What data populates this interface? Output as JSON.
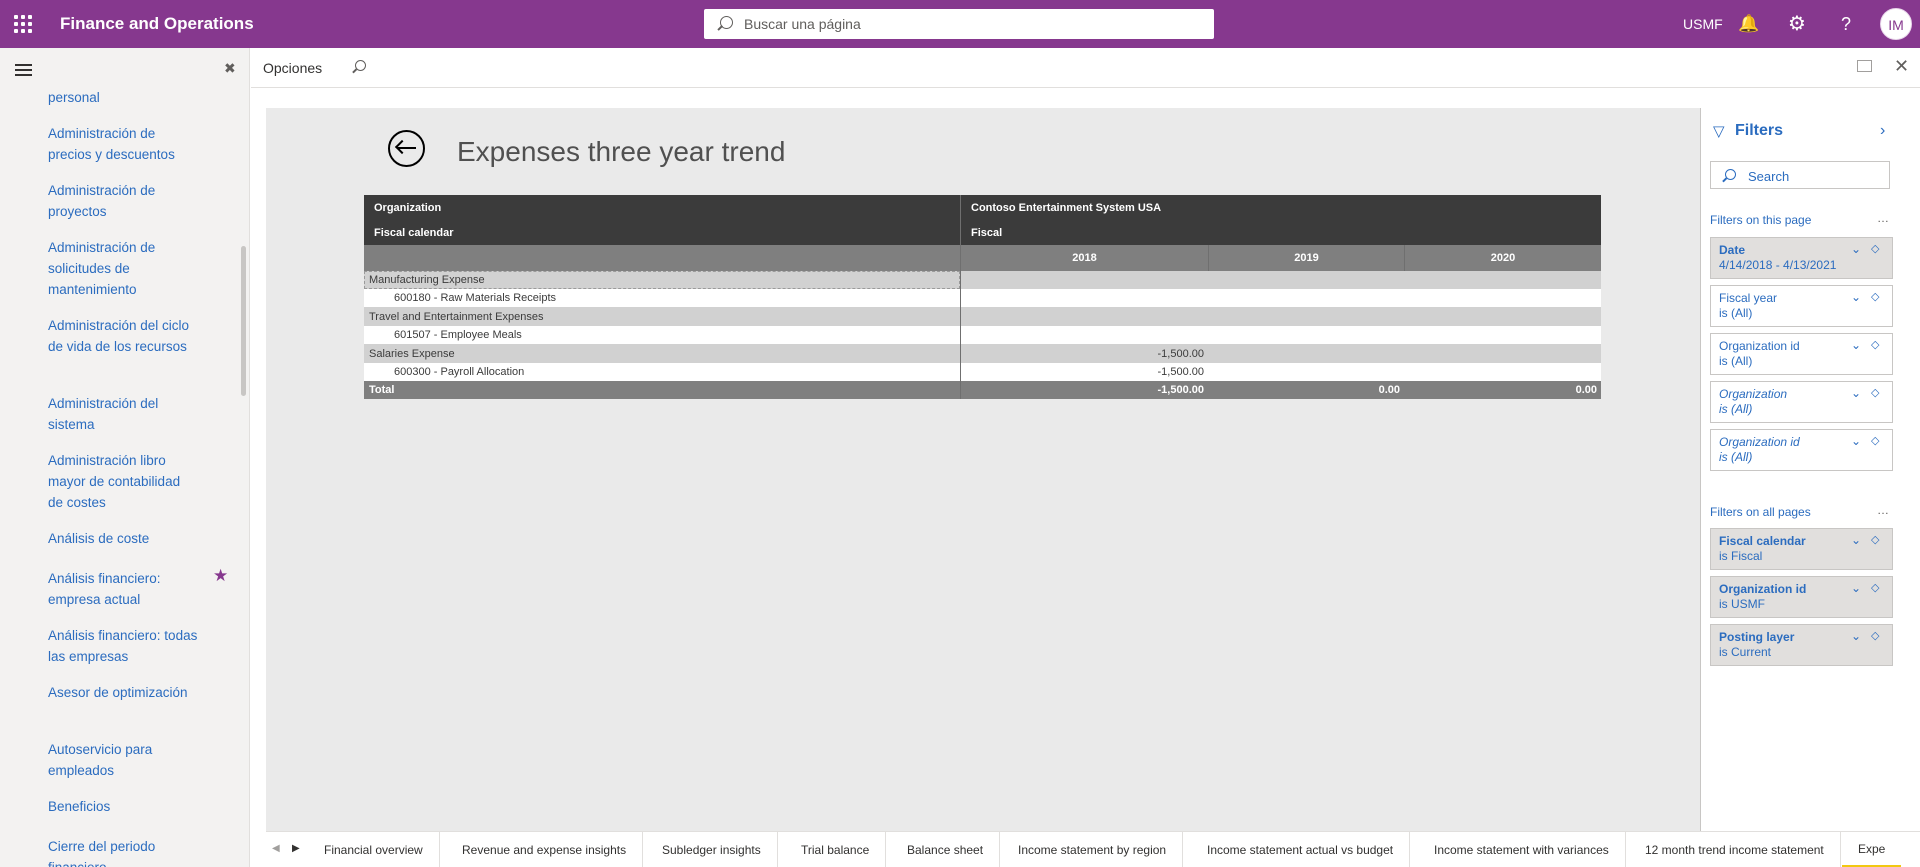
{
  "app": {
    "title": "Finance and Operations",
    "search_placeholder": "Buscar una página",
    "company": "USMF",
    "user_initials": "IM"
  },
  "nav": {
    "items": [
      {
        "label": "personal"
      },
      {
        "label": "Administración de precios y descuentos"
      },
      {
        "label": "Administración de proyectos"
      },
      {
        "label": "Administración de solicitudes de mantenimiento"
      },
      {
        "label": "Administración del ciclo de vida de los recursos"
      },
      {
        "label": "Administración del sistema"
      },
      {
        "label": "Administración libro mayor de contabilidad de costes"
      },
      {
        "label": "Análisis de coste"
      },
      {
        "label": "Análisis financiero: empresa actual"
      },
      {
        "label": "Análisis financiero: todas las empresas"
      },
      {
        "label": "Asesor de optimización"
      },
      {
        "label": "Autoservicio para empleados"
      },
      {
        "label": "Beneficios"
      },
      {
        "label": "Cierre del periodo financiero"
      }
    ]
  },
  "command": {
    "label": "Opciones"
  },
  "report": {
    "title": "Expenses three year trend",
    "header": {
      "org_label": "Organization",
      "org_value": "Contoso Entertainment System USA",
      "cal_label": "Fiscal calendar",
      "cal_value": "Fiscal",
      "years": [
        "2018",
        "2019",
        "2020"
      ]
    },
    "rows": [
      {
        "kind": "group",
        "label": "Manufacturing Expense",
        "v2018": "",
        "v2019": "",
        "v2020": ""
      },
      {
        "kind": "detail",
        "label": "600180 - Raw Materials Receipts",
        "v2018": "",
        "v2019": "",
        "v2020": ""
      },
      {
        "kind": "group",
        "label": "Travel and Entertainment Expenses",
        "v2018": "",
        "v2019": "",
        "v2020": ""
      },
      {
        "kind": "detail",
        "label": "601507 - Employee Meals",
        "v2018": "",
        "v2019": "",
        "v2020": ""
      },
      {
        "kind": "group",
        "label": "Salaries Expense",
        "v2018": "-1,500.00",
        "v2019": "",
        "v2020": ""
      },
      {
        "kind": "detail",
        "label": "600300 - Payroll Allocation",
        "v2018": "-1,500.00",
        "v2019": "",
        "v2020": ""
      }
    ],
    "total": {
      "label": "Total",
      "v2018": "-1,500.00",
      "v2019": "0.00",
      "v2020": "0.00"
    }
  },
  "tabs": [
    {
      "label": "Financial overview"
    },
    {
      "label": "Revenue and expense insights"
    },
    {
      "label": "Subledger insights"
    },
    {
      "label": "Trial balance"
    },
    {
      "label": "Balance sheet"
    },
    {
      "label": "Income statement by region"
    },
    {
      "label": "Income statement actual vs budget"
    },
    {
      "label": "Income statement with variances"
    },
    {
      "label": "12 month trend income statement"
    },
    {
      "label": "Expe"
    }
  ],
  "filters": {
    "title": "Filters",
    "search_placeholder": "Search",
    "page_section": "Filters on this page",
    "all_section": "Filters on all pages",
    "page_filters": [
      {
        "title": "Date",
        "value": "4/14/2018 - 4/13/2021"
      },
      {
        "title": "Fiscal year",
        "value": "is (All)"
      },
      {
        "title": "Organization id",
        "value": "is (All)"
      },
      {
        "title": "Organization",
        "value": "is (All)"
      },
      {
        "title": "Organization id",
        "value": "is (All)"
      }
    ],
    "all_filters": [
      {
        "title": "Fiscal calendar",
        "value": "is Fiscal"
      },
      {
        "title": "Organization id",
        "value": "is USMF"
      },
      {
        "title": "Posting layer",
        "value": "is Current"
      }
    ]
  },
  "colors": {
    "brand": "#86388e",
    "link": "#2b6cbf",
    "tab_active": "#f2c811"
  }
}
